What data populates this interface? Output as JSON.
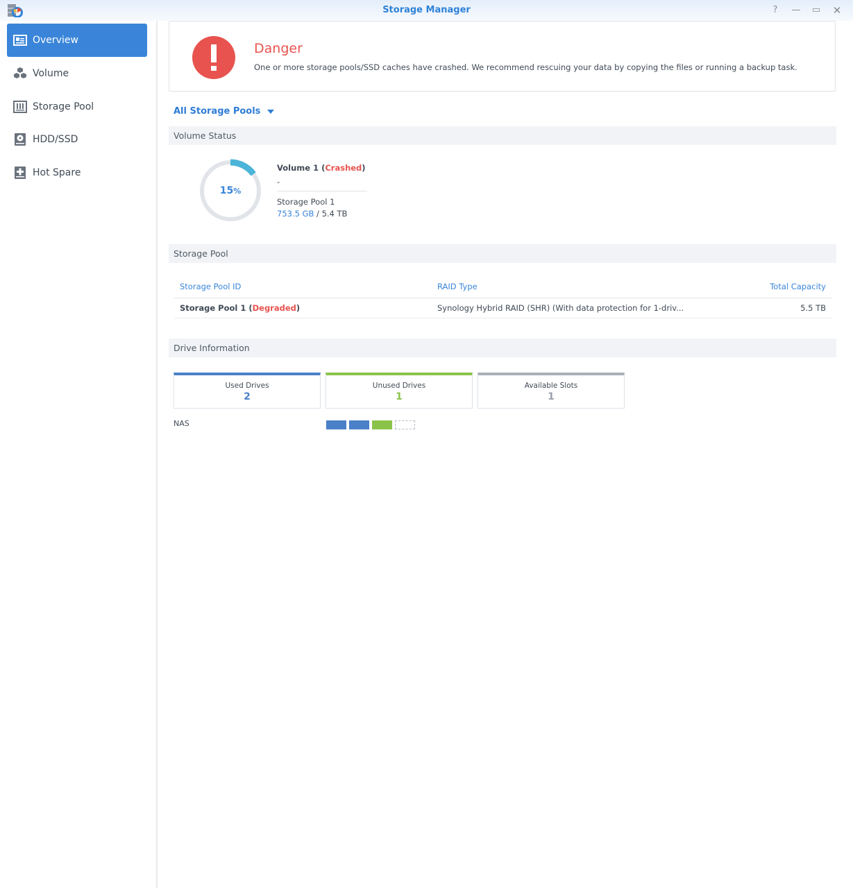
{
  "window": {
    "title": "Storage Manager",
    "controls": [
      {
        "name": "help",
        "icon": "help-icon",
        "glyph": "?"
      },
      {
        "name": "minimize",
        "icon": "minimize-icon",
        "glyph": "—"
      },
      {
        "name": "maximize",
        "icon": "maximize-icon",
        "glyph": "▭"
      },
      {
        "name": "close",
        "icon": "close-icon",
        "glyph": "✕"
      }
    ]
  },
  "sidebar": {
    "items": [
      {
        "label": "Overview",
        "icon": "overview-icon",
        "active": true
      },
      {
        "label": "Volume",
        "icon": "volume-cubes-icon",
        "active": false
      },
      {
        "label": "Storage Pool",
        "icon": "storage-pool-icon",
        "active": false
      },
      {
        "label": "HDD/SSD",
        "icon": "hdd-icon",
        "active": false
      },
      {
        "label": "Hot Spare",
        "icon": "hot-spare-icon",
        "active": false
      }
    ]
  },
  "alert": {
    "icon": "exclamation-circle-icon",
    "title": "Danger",
    "message": "One or more storage pools/SSD caches have crashed. We recommend rescuing your data by copying the files or running a backup task."
  },
  "filter": {
    "selected": "All Storage Pools"
  },
  "volume_status": {
    "header": "Volume Status",
    "usage_percent": 15,
    "usage_percent_number": "15",
    "usage_percent_sign": "%",
    "name": "Volume 1",
    "status": "Crashed",
    "description": "-",
    "pool": "Storage Pool 1",
    "used": "753.5 GB",
    "total": "5.4 TB"
  },
  "storage_pool": {
    "header": "Storage Pool",
    "columns": [
      "Storage Pool ID",
      "RAID Type",
      "Total Capacity"
    ],
    "rows": [
      {
        "id": "Storage Pool 1",
        "status": "Degraded",
        "raid": "Synology Hybrid RAID (SHR) (With data protection for 1-driv...",
        "capacity": "5.5 TB"
      }
    ]
  },
  "drive_info": {
    "header": "Drive Information",
    "cards": [
      {
        "label": "Used Drives",
        "value": "2"
      },
      {
        "label": "Unused Drives",
        "value": "1"
      },
      {
        "label": "Available Slots",
        "value": "1"
      }
    ],
    "device_label": "NAS",
    "slots": [
      "used",
      "used",
      "unused",
      "empty"
    ]
  },
  "colors": {
    "accent": "#3a85d9",
    "danger": "#e8534f",
    "used": "#4a80c8",
    "unused": "#8bc34a",
    "empty": "#aab0b8",
    "donut_fill": "#4bb4d8",
    "donut_track": "#e1e4e8"
  }
}
